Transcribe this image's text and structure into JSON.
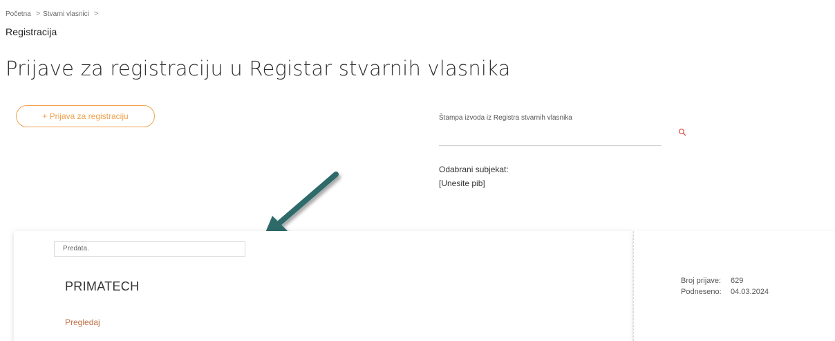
{
  "breadcrumb": {
    "items": [
      "Početna",
      "Stvarni vlasnici"
    ],
    "separator": ">",
    "current": "Registracija"
  },
  "page": {
    "title": "Prijave za registraciju u Registar stvarnih vlasnika"
  },
  "actions": {
    "add_label": "+ Prijava za registraciju"
  },
  "print_extract": {
    "label": "Štampa izvoda iz Registra stvarnih vlasnika",
    "value": "",
    "search_icon": "search-icon"
  },
  "selected_subject": {
    "label": "Odabrani subjekat:",
    "value": "[Unesite pib]"
  },
  "annotation": {
    "icon": "arrow-icon",
    "color": "#2e6a6b"
  },
  "application": {
    "status": "Predata.",
    "company": "PRIMATECH",
    "review_label": "Pregledaj",
    "number_label": "Broj prijave:",
    "number_value": "629",
    "submitted_label": "Podneseno:",
    "submitted_value": "04.03.2024"
  },
  "colors": {
    "accent": "#f0a24d",
    "link": "#c0704a",
    "search_icon": "#d9534f",
    "arrow": "#2e6a6b"
  }
}
